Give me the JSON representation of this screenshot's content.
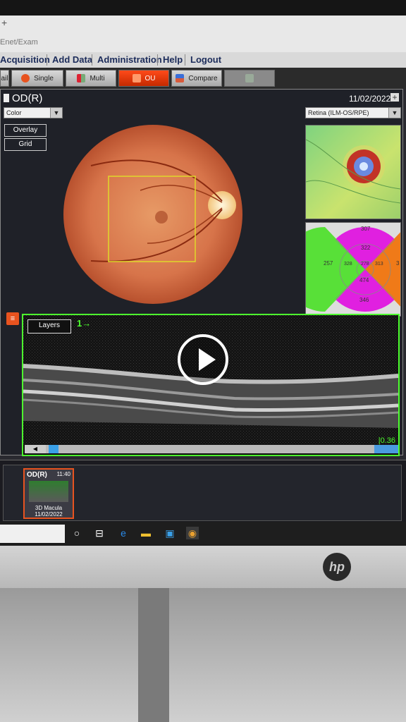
{
  "browser": {
    "new_tab_symbol": "+",
    "url": "Enet/Exam"
  },
  "menu": {
    "items": [
      "Acquisition",
      "Add Data",
      "Administration",
      "Help",
      "Logout"
    ]
  },
  "toolbar": {
    "partial_left": "ail",
    "single": "Single",
    "multi": "Multi",
    "ou": "OU",
    "compare": "Compare"
  },
  "panel": {
    "eye": "OD(R)",
    "date": "11/02/2022",
    "color_select": "Color",
    "overlay": "Overlay",
    "grid": "Grid",
    "retina_select": "Retina (ILM-OS/RPE)"
  },
  "etdrs": {
    "center": "278",
    "inner_superior": "322",
    "inner_nasal": "313",
    "inner_inferior": "474",
    "inner_temporal": "328",
    "outer_superior": "307",
    "outer_temporal": "257",
    "outer_inferior": "346",
    "outer_nasal": "3"
  },
  "bscan": {
    "layers_button": "Layers",
    "slice_label": "1→",
    "zoom": "|0.36"
  },
  "thumbnail": {
    "eye": "OD(R)",
    "time": "11:40",
    "scan_type": "3D Macula",
    "date": "11/02/2022"
  },
  "monitor": {
    "brand": "hp"
  },
  "colors": {
    "accent_active": "#e8531f",
    "oct_border": "#4dff2e",
    "menu_text": "#1b2b5a"
  }
}
